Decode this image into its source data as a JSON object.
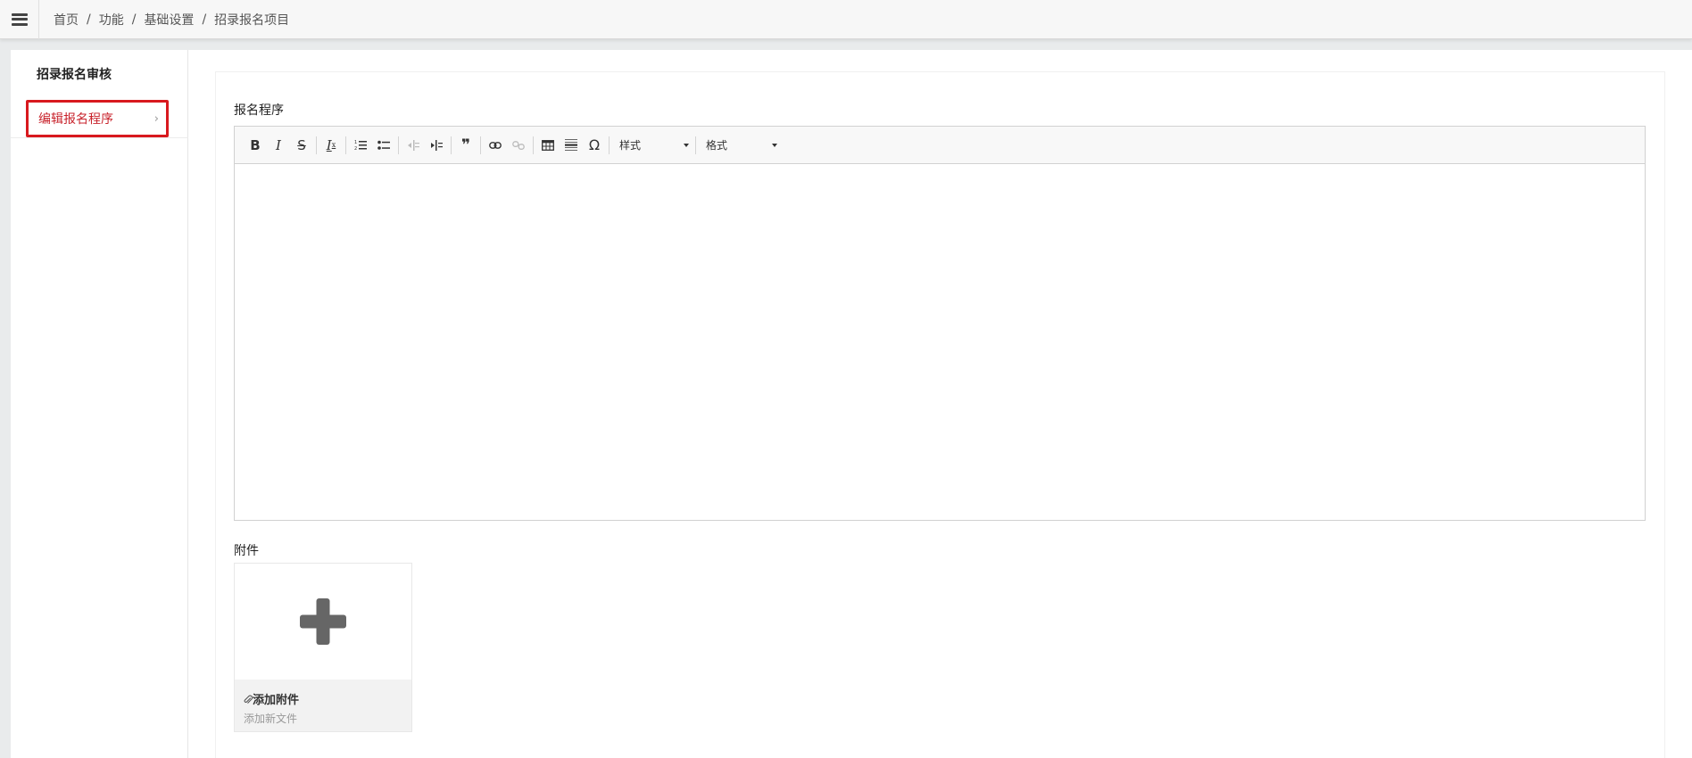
{
  "header": {
    "breadcrumb": [
      "首页",
      "功能",
      "基础设置",
      "招录报名项目"
    ],
    "separator": "/"
  },
  "sidebar": {
    "items": [
      {
        "label": "招录报名审核",
        "active": false
      },
      {
        "label": "编辑报名程序",
        "active": true,
        "chevron": "›"
      }
    ]
  },
  "form": {
    "program_label": "报名程序",
    "attachment_label": "附件"
  },
  "editor": {
    "toolbar": {
      "bold": "B",
      "italic": "I",
      "strike": "S",
      "clear_format": "I",
      "clear_format_sub": "x",
      "quote": "❞",
      "special_char": "Ω",
      "style_combo": "样式",
      "format_combo": "格式"
    },
    "content": ""
  },
  "attachment": {
    "title": "添加附件",
    "subtitle": "添加新文件"
  },
  "colors": {
    "active_item": "#c8232c",
    "highlight_border": "#d8191e",
    "plus_icon": "#666666"
  }
}
